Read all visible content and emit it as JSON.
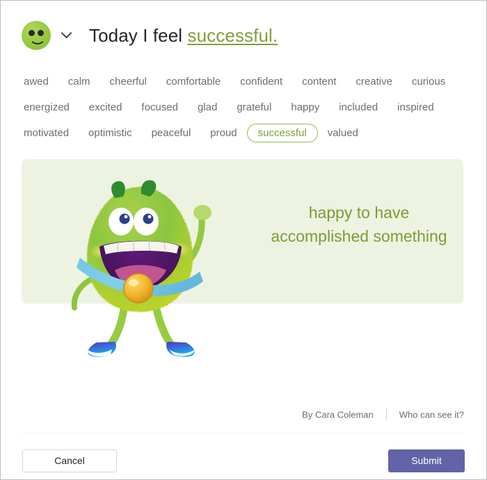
{
  "header": {
    "avatar_icon": "smiley-face-green-icon",
    "dropdown_icon": "chevron-down-icon",
    "title_prefix": "Today I feel ",
    "mood_word": "successful.",
    "accent_color": "#7f9f39"
  },
  "words": {
    "rows": [
      [
        "awed",
        "calm",
        "cheerful",
        "comfortable",
        "confident",
        "content",
        "creative",
        "curious"
      ],
      [
        "energized",
        "excited",
        "focused",
        "glad",
        "grateful",
        "happy",
        "included",
        "inspired"
      ],
      [
        "motivated",
        "optimistic",
        "peaceful",
        "proud",
        "successful",
        "valued"
      ]
    ],
    "selected": "successful"
  },
  "panel": {
    "background_color": "#eef3e1",
    "caption_line1": "happy to have",
    "caption_line2": "accomplished something",
    "caption_color": "#7c9c37",
    "illustration": "green-furry-monster-with-medal-illustration"
  },
  "meta": {
    "author": "By Cara Coleman",
    "visibility_link": "Who can see it?"
  },
  "actions": {
    "cancel_label": "Cancel",
    "submit_label": "Submit",
    "submit_color": "#6264a7"
  }
}
